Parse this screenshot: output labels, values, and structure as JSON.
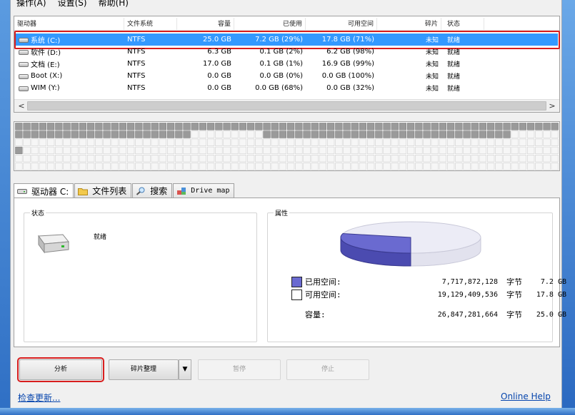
{
  "menu": [
    "操作(A)",
    "设置(S)",
    "帮助(H)"
  ],
  "drive_list": {
    "columns": [
      "驱动器",
      "文件系统",
      "容量",
      "已使用",
      "可用空间",
      "碎片",
      "状态"
    ],
    "rows": [
      {
        "name": "系统 (C:)",
        "fs": "NTFS",
        "capacity": "25.0 GB",
        "used": "7.2 GB (29%)",
        "free": "17.8 GB (71%)",
        "frag": "未知",
        "status": "就绪",
        "selected": true
      },
      {
        "name": "软件 (D:)",
        "fs": "NTFS",
        "capacity": "6.3 GB",
        "used": "0.1 GB (2%)",
        "free": "6.2 GB (98%)",
        "frag": "未知",
        "status": "就绪"
      },
      {
        "name": "文档 (E:)",
        "fs": "NTFS",
        "capacity": "17.0 GB",
        "used": "0.1 GB (1%)",
        "free": "16.9 GB (99%)",
        "frag": "未知",
        "status": "就绪"
      },
      {
        "name": "Boot (X:)",
        "fs": "NTFS",
        "capacity": "0.0 GB",
        "used": "0.0 GB (0%)",
        "free": "0.0 GB (100%)",
        "frag": "未知",
        "status": "就绪"
      },
      {
        "name": "WIM (Y:)",
        "fs": "NTFS",
        "capacity": "0.0 GB",
        "used": "0.0 GB (68%)",
        "free": "0.0 GB (32%)",
        "frag": "未知",
        "status": "就绪"
      }
    ],
    "scroll_left": "<",
    "scroll_right": ">"
  },
  "tabs": [
    {
      "label": "驱动器 C:",
      "active": true
    },
    {
      "label": "文件列表"
    },
    {
      "label": "搜索"
    },
    {
      "label": "Drive map"
    }
  ],
  "status_group": {
    "title": "状态",
    "value": "就绪"
  },
  "props_group": {
    "title": "属性",
    "used_label": "已用空间:",
    "used_bytes": "7,717,872,128",
    "used_unit": "字节",
    "used_gb": "7.2 GB",
    "free_label": "可用空间:",
    "free_bytes": "19,129,409,536",
    "free_unit": "字节",
    "free_gb": "17.8 GB",
    "cap_label": "容量:",
    "cap_bytes": "26,847,281,664",
    "cap_unit": "字节",
    "cap_gb": "25.0 GB",
    "used_fraction": 0.29,
    "used_color": "#6a6ad0",
    "free_color": "#ececf6"
  },
  "buttons": {
    "analyze": "分析",
    "defrag": "碎片整理",
    "defrag_arrow": "▼",
    "pause": "暂停",
    "stop": "停止"
  },
  "links": {
    "check_updates": "检查更新...",
    "online_help": "Online Help"
  }
}
